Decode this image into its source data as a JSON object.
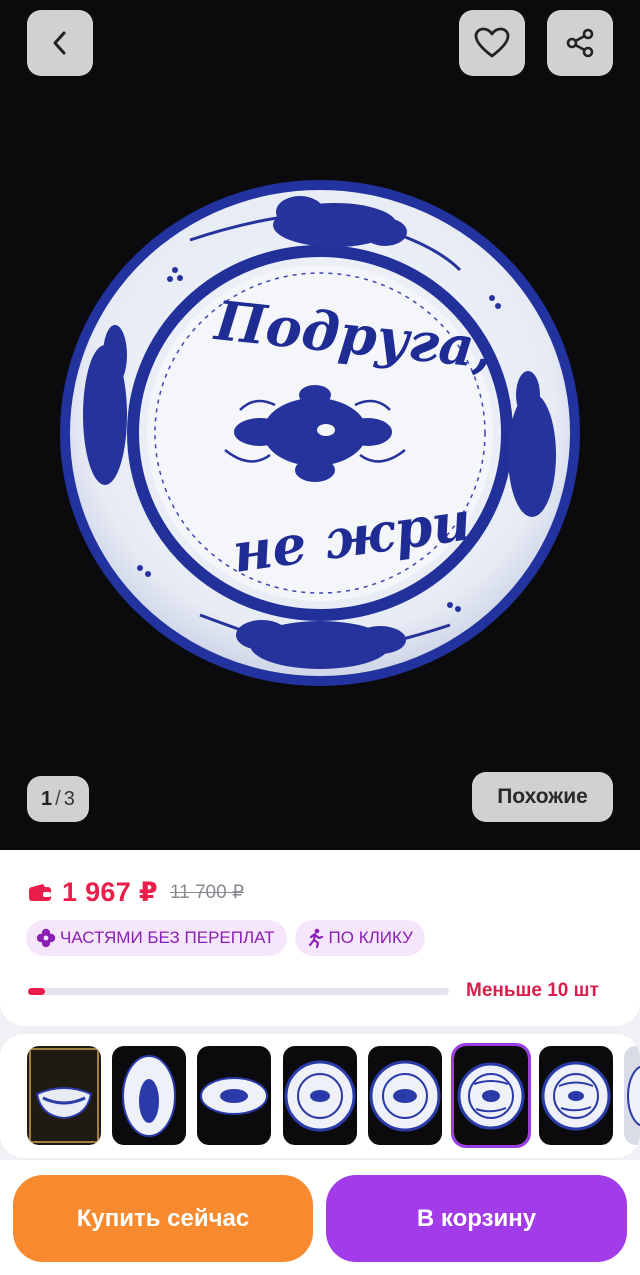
{
  "gallery": {
    "current": "1",
    "total": "3",
    "similar_label": "Похожие",
    "plate_text_line1": "Подруга,",
    "plate_text_line2": "не жри"
  },
  "price": {
    "current": "1 967 ₽",
    "old": "11 700 ₽",
    "color": "#ea1e4a"
  },
  "badges": [
    {
      "label": "ЧАСТЯМИ БЕЗ ПЕРЕПЛАТ",
      "icon": "flower-icon"
    },
    {
      "label": "ПО КЛИКУ",
      "icon": "running-person-icon"
    }
  ],
  "stock": {
    "label": "Меньше 10 шт",
    "level": 0.04
  },
  "variants": {
    "selected_index": 5,
    "count_visible": 8
  },
  "actions": {
    "buy_now": "Купить сейчас",
    "add_to_cart": "В корзину",
    "buy_color": "#f78a2e",
    "cart_color": "#a23be8"
  }
}
